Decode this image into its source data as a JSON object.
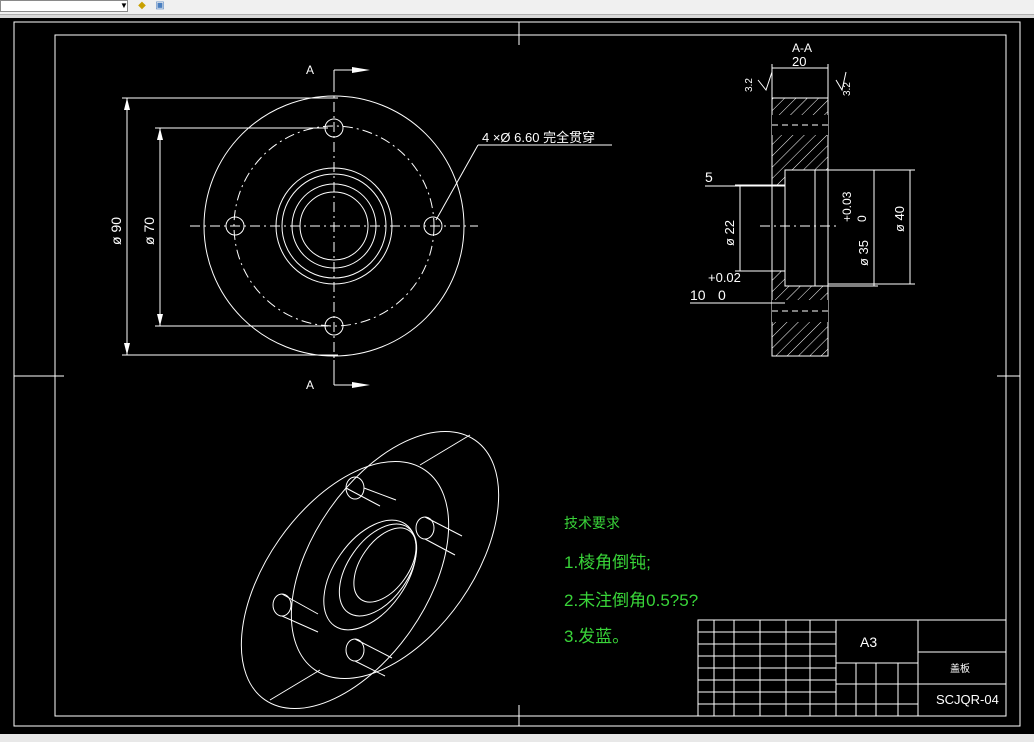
{
  "toolbar": {
    "combo_value": "",
    "icons": [
      "layer-icon",
      "layers-stack-icon"
    ]
  },
  "drawing": {
    "section_label_top": "A",
    "section_label_bottom": "A",
    "hole_note": "4 ×Ø 6.60 完全贯穿",
    "dim_d90": "ø 90",
    "dim_d70": "ø 70",
    "section_title": "A-A",
    "dim_20": "20",
    "roughness_left": "3.2",
    "roughness_right": "3.2",
    "dim_5": "5",
    "dim_d22": "ø 22",
    "tol_upper_003": "+0.03",
    "tol_lower_0_a": "0",
    "dim_d35": "ø 35",
    "dim_d40": "ø 40",
    "tol_upper_002": "+0.02",
    "dim_10": "10",
    "tol_lower_0_b": "0"
  },
  "tech_requirements": {
    "title": "技术要求",
    "items": [
      "1.棱角倒钝;",
      "2.未注倒角0.5?5?",
      "3.发蓝。"
    ]
  },
  "title_block": {
    "sheet_size": "A3",
    "part_name": "盖板",
    "drawing_number": "SCJQR-04"
  },
  "status": {
    "text": ""
  }
}
